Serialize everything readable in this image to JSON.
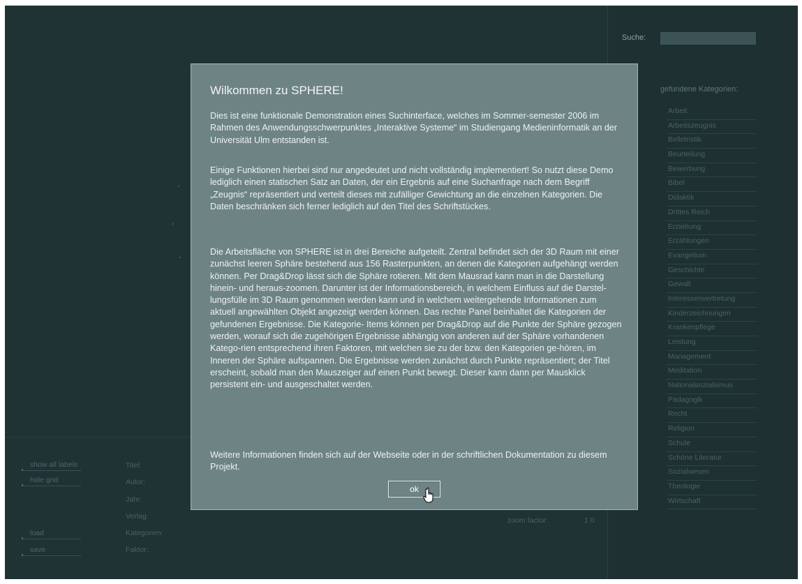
{
  "search": {
    "label": "Suche:",
    "value": ""
  },
  "categories": {
    "header": "gefundene Kategorien:",
    "items": [
      "Arbeit",
      "Arbeitszeugnis",
      "Belletristik",
      "Beurteilung",
      "Bewerbung",
      "Bibel",
      "Didaktik",
      "Drittes Reich",
      "Erziehung",
      "Erzählungen",
      "Evangelium",
      "Geschichte",
      "Gewalt",
      "Interessenvertretung",
      "Kinderzeichnungen",
      "Krankenpflege",
      "Leistung",
      "Management",
      "Meditation",
      "Nationalsozialismus",
      "Pädagogik",
      "Recht",
      "Religion",
      "Schule",
      "Schöne Literatur",
      "Sozialwesen",
      "Theologie",
      "Wirtschaft"
    ]
  },
  "controls": {
    "show_labels": "show all labels",
    "hide_grid": "hide grid",
    "load": "load",
    "save": "save"
  },
  "info_fields": {
    "title": "Titel:",
    "author": "Autor:",
    "year": "Jahr:",
    "publisher": "Verlag:",
    "categories": "Kategorien:",
    "factor": "Faktor:"
  },
  "zoom": {
    "label": "zoom factor:",
    "value": "1 0"
  },
  "modal": {
    "title": "Wilkommen zu SPHERE!",
    "p1": "Dies ist eine funktionale Demonstration eines Suchinterface, welches im Sommer-semester 2006 im Rahmen des Anwendungsschwerpunktes „Interaktive Systeme“ im Studiengang Medieninformatik an der Universität Ulm entstanden ist.",
    "p2": "Einige Funktionen hierbei sind nur angedeutet und nicht vollständig implementiert! So nutzt diese Demo lediglich einen statischen Satz an Daten, der ein Ergebnis auf eine Suchanfrage nach dem Begriff „Zeugnis“ repräsentiert und verteilt dieses mit zufälliger Gewichtung an die einzelnen Kategorien. Die Daten beschränken sich ferner lediglich auf den Titel des Schriftstückes.",
    "p3": "Die Arbeitsfläche von SPHERE ist in drei Bereiche aufgeteilt. Zentral befindet sich der 3D Raum mit einer zunächst leeren Sphäre bestehend aus 156 Rasterpunkten, an denen die Kategorien aufgehängt werden können. Per Drag&Drop lässt sich die Sphäre rotieren. Mit dem Mausrad kann man in die Darstellung hinein- und heraus-zoomen. Darunter ist der Informationsbereich, in welchem Einfluss auf die Darstel-lungsfülle im 3D Raum genommen werden kann und in welchem weitergehende Informationen zum aktuell angewählten Objekt angezeigt werden können. Das rechte Panel beinhaltet die Kategorien der gefundenen Ergebnisse. Die Kategorie- Items können per Drag&Drop auf die Punkte der Sphäre gezogen werden, worauf sich die zugehörigen Ergebnisse abhängig von anderen auf der Sphäre vorhandenen Katego-rien entsprechend ihren Faktoren, mit welchen sie zu der bzw. den Kategorien ge-hören, im Inneren der Sphäre aufspannen. Die Ergebnisse werden zunächst durch Punkte repräsentiert; der Titel erscheint, sobald man den Mauszeiger auf einen Punkt bewegt. Dieser kann dann per Mausklick persistent ein-  und ausgeschaltet werden.",
    "p4": "Weitere Informationen finden sich auf der Webseite oder in der schriftlichen Dokumentation zu diesem Projekt.",
    "ok": "ok"
  }
}
